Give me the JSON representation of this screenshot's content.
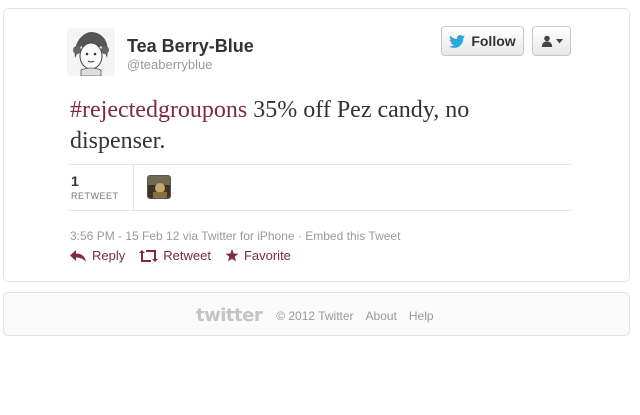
{
  "author": {
    "name": "Tea Berry-Blue",
    "handle": "@teaberryblue"
  },
  "buttons": {
    "follow_label": "Follow",
    "follow_icon": "twitter-bird-icon",
    "user_menu_icon": "user-dropdown-icon"
  },
  "tweet": {
    "hashtag": "#rejectedgroupons",
    "text": " 35% off Pez candy, no dispenser."
  },
  "stats": {
    "retweet_count": "1",
    "retweet_label": "RETWEET"
  },
  "meta": {
    "timestamp": "3:56 PM - 15 Feb 12",
    "via": " via Twitter for iPhone",
    "separator": " · ",
    "embed": "Embed this Tweet"
  },
  "actions": {
    "reply": "Reply",
    "retweet": "Retweet",
    "favorite": "Favorite"
  },
  "footer": {
    "logo": "twitter",
    "copyright": "© 2012 Twitter",
    "about": "About",
    "help": "Help"
  },
  "colors": {
    "accent": "#7e2a3f",
    "muted": "#999999",
    "follow_bird": "#2fa5de"
  }
}
